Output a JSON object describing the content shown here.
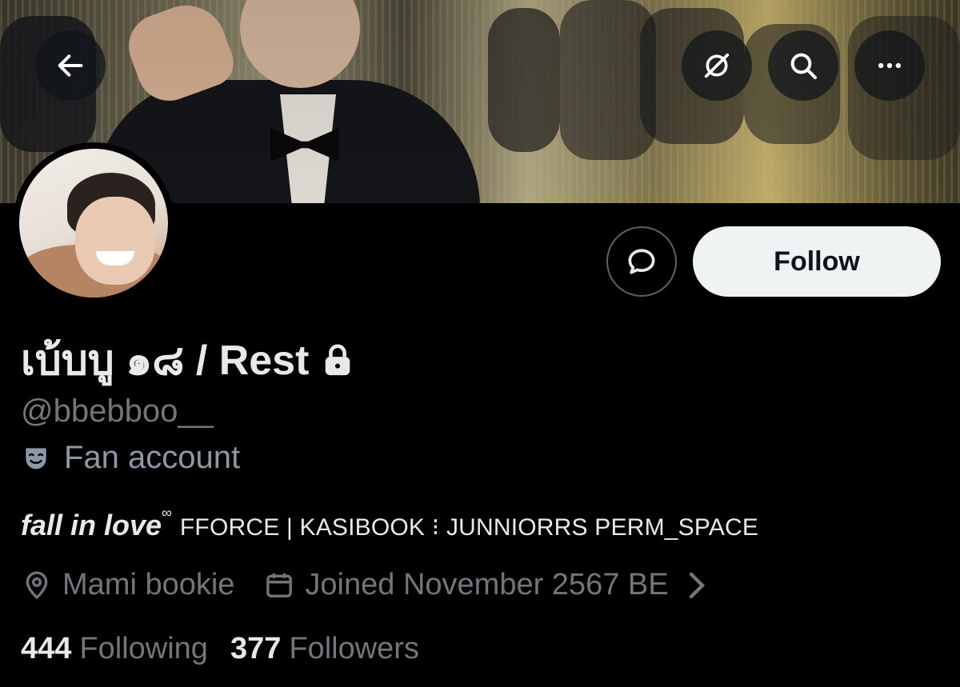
{
  "header": {
    "back_icon": "arrow-left-icon",
    "grok_icon": "grok-icon",
    "search_icon": "search-icon",
    "more_icon": "more-icon"
  },
  "profile": {
    "display_name": "เบ้บบู ๑๘ / Rest",
    "handle": "@bbebboo__",
    "protected_icon": "lock-icon",
    "label": "Fan account",
    "label_icon": "theater-mask-icon",
    "bio": {
      "styled": "fall in love",
      "sup": "∞",
      "text": "FFORCE | KASIBOOK ⁝ JUNNIORRS PERM_SPACE"
    },
    "location": "Mami bookie",
    "joined": "Joined November 2567 BE",
    "following_count": "444",
    "following_label": "Following",
    "followers_count": "377",
    "followers_label": "Followers"
  },
  "actions": {
    "message_icon": "message-bubble-icon",
    "follow_label": "Follow"
  },
  "colors": {
    "background": "#000000",
    "text_primary": "#e7e9ea",
    "text_secondary": "#71767b",
    "follow_bg": "#eff3f4",
    "border": "#536471"
  }
}
